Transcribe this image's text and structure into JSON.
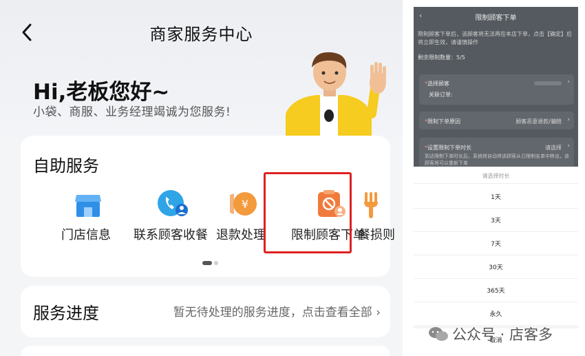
{
  "left": {
    "nav_title": "商家服务中心",
    "greeting": "Hi,老板您好~",
    "greeting_sub": "小袋、商服、业务经理竭诚为您服务!",
    "self_service": {
      "title": "自助服务",
      "items": [
        {
          "label": "门店信息",
          "icon": "storefront-icon"
        },
        {
          "label": "联系顾客收餐",
          "icon": "phone-user-icon"
        },
        {
          "label": "退款处理",
          "icon": "refund-yen-icon"
        },
        {
          "label": "限制顾客下单",
          "icon": "restrict-order-icon"
        },
        {
          "label": "餐损则",
          "icon": "fork-icon"
        }
      ]
    },
    "progress": {
      "title": "服务进度",
      "link": "暂无待处理的服务进度，点击查看全部"
    }
  },
  "right": {
    "title": "限制顾客下单",
    "notice": "限制顾客下单后，该顾客将无法再在本店下单，点击【确定】后将立即生效，请谨慎操作",
    "remaining": "剩余限制数量：5/5",
    "select_customer": "选择顾客",
    "related_order": "关联订单:",
    "reason_label": "限制下单原因",
    "reason_value": "顾客恶意退款/骗赔",
    "duration_label": "设置限制下单时长",
    "duration_value": "请选择",
    "duration_desc": "到达限制下单时长后，系统将自动将该顾客从已限制名单中移出，该顾客将可以重新下单",
    "sheet": {
      "title": "请选择时长",
      "options": [
        "1天",
        "3天",
        "7天",
        "30天",
        "365天",
        "永久"
      ],
      "cancel": "取消"
    }
  },
  "watermark": "公众号 · 店客多",
  "colors": {
    "accent_red": "#e02020",
    "brand_blue": "#2f8fe8",
    "brand_orange": "#f07a3c"
  }
}
